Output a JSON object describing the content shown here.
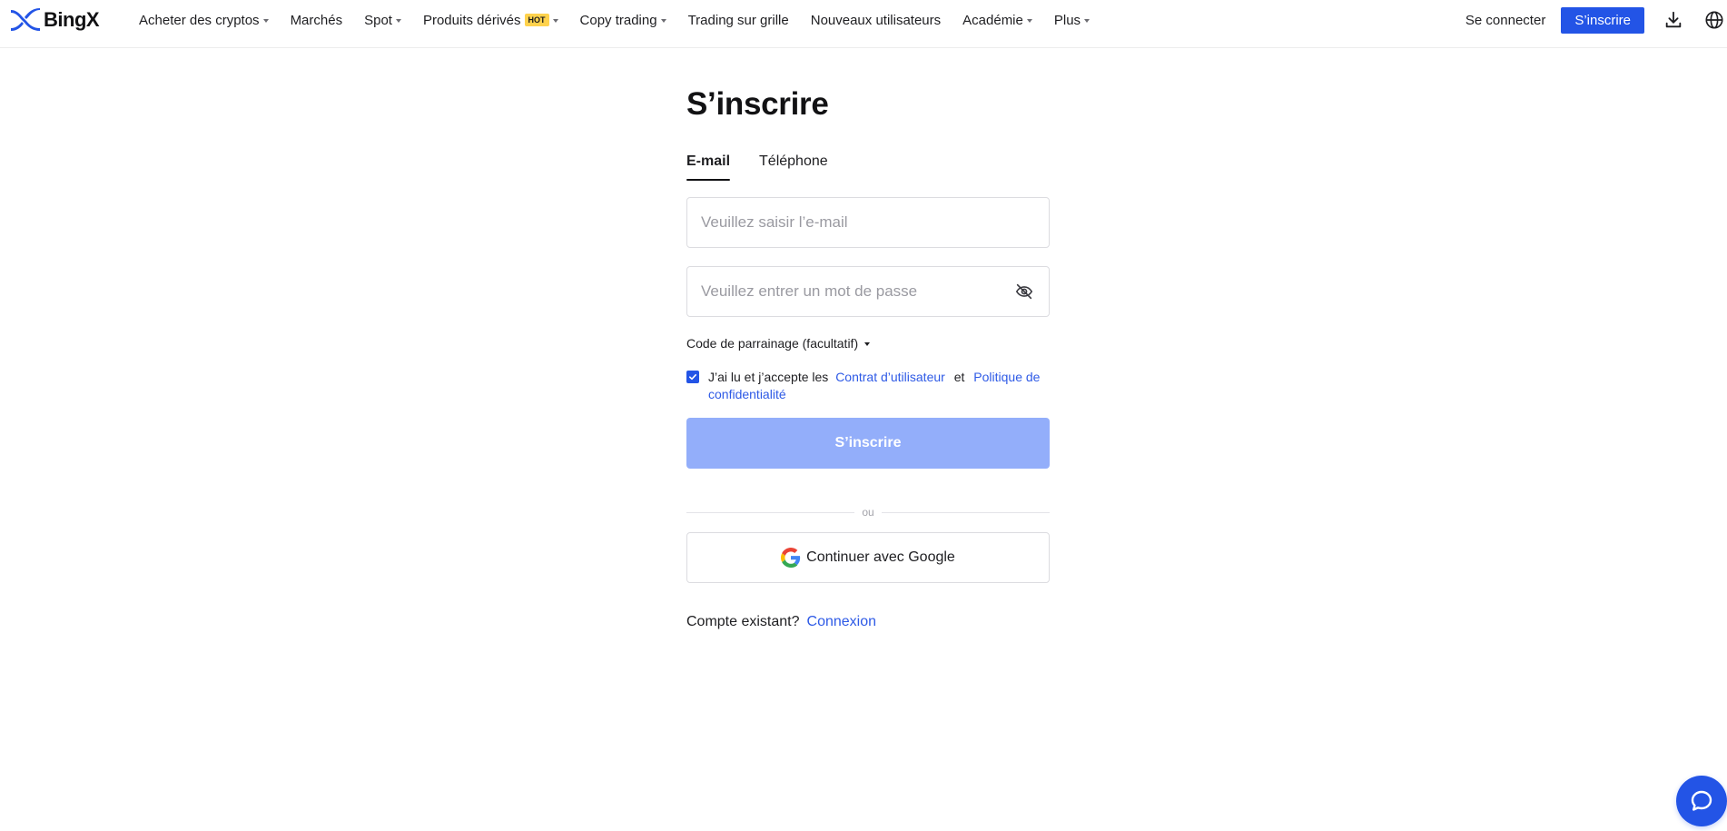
{
  "brand": {
    "name": "BingX",
    "color": "#2354e6"
  },
  "nav": {
    "items": [
      {
        "label": "Acheter des cryptos",
        "dropdown": true,
        "badge": ""
      },
      {
        "label": "Marchés",
        "dropdown": false,
        "badge": ""
      },
      {
        "label": "Spot",
        "dropdown": true,
        "badge": ""
      },
      {
        "label": "Produits dérivés",
        "dropdown": true,
        "badge": "HOT"
      },
      {
        "label": "Copy trading",
        "dropdown": true,
        "badge": ""
      },
      {
        "label": "Trading sur grille",
        "dropdown": false,
        "badge": ""
      },
      {
        "label": "Nouveaux utilisateurs",
        "dropdown": false,
        "badge": ""
      },
      {
        "label": "Académie",
        "dropdown": true,
        "badge": ""
      },
      {
        "label": "Plus",
        "dropdown": true,
        "badge": ""
      }
    ]
  },
  "header": {
    "login_label": "Se connecter",
    "signup_label": "S’inscrire",
    "download_icon": "download-icon",
    "language_icon": "globe-icon"
  },
  "form": {
    "title": "S’inscrire",
    "tabs": [
      {
        "label": "E-mail",
        "active": true
      },
      {
        "label": "Téléphone",
        "active": false
      }
    ],
    "email": {
      "value": "",
      "placeholder": "Veuillez saisir l’e-mail"
    },
    "password": {
      "value": "",
      "placeholder": "Veuillez entrer un mot de passe",
      "toggle_icon": "eye-off-icon"
    },
    "referral_label": "Code de parrainage (facultatif)",
    "agree": {
      "checked": true,
      "text": "J’ai lu et j’accepte les",
      "terms_link": "Contrat d’utilisateur",
      "conjunction": "et",
      "privacy_link": "Politique de confidentialité"
    },
    "submit_label": "S’inscrire",
    "divider_label": "ou",
    "google_label": "Continuer avec Google",
    "existing_text": "Compte existant?",
    "existing_link": "Connexion"
  },
  "chat": {
    "icon": "chat-bubble-icon"
  },
  "colors": {
    "primary": "#2354e6",
    "primary_disabled": "#93aefa",
    "link": "#2e5ae6",
    "hot_badge": "#ffd24d",
    "text": "#121214",
    "border": "#dcdce0"
  }
}
